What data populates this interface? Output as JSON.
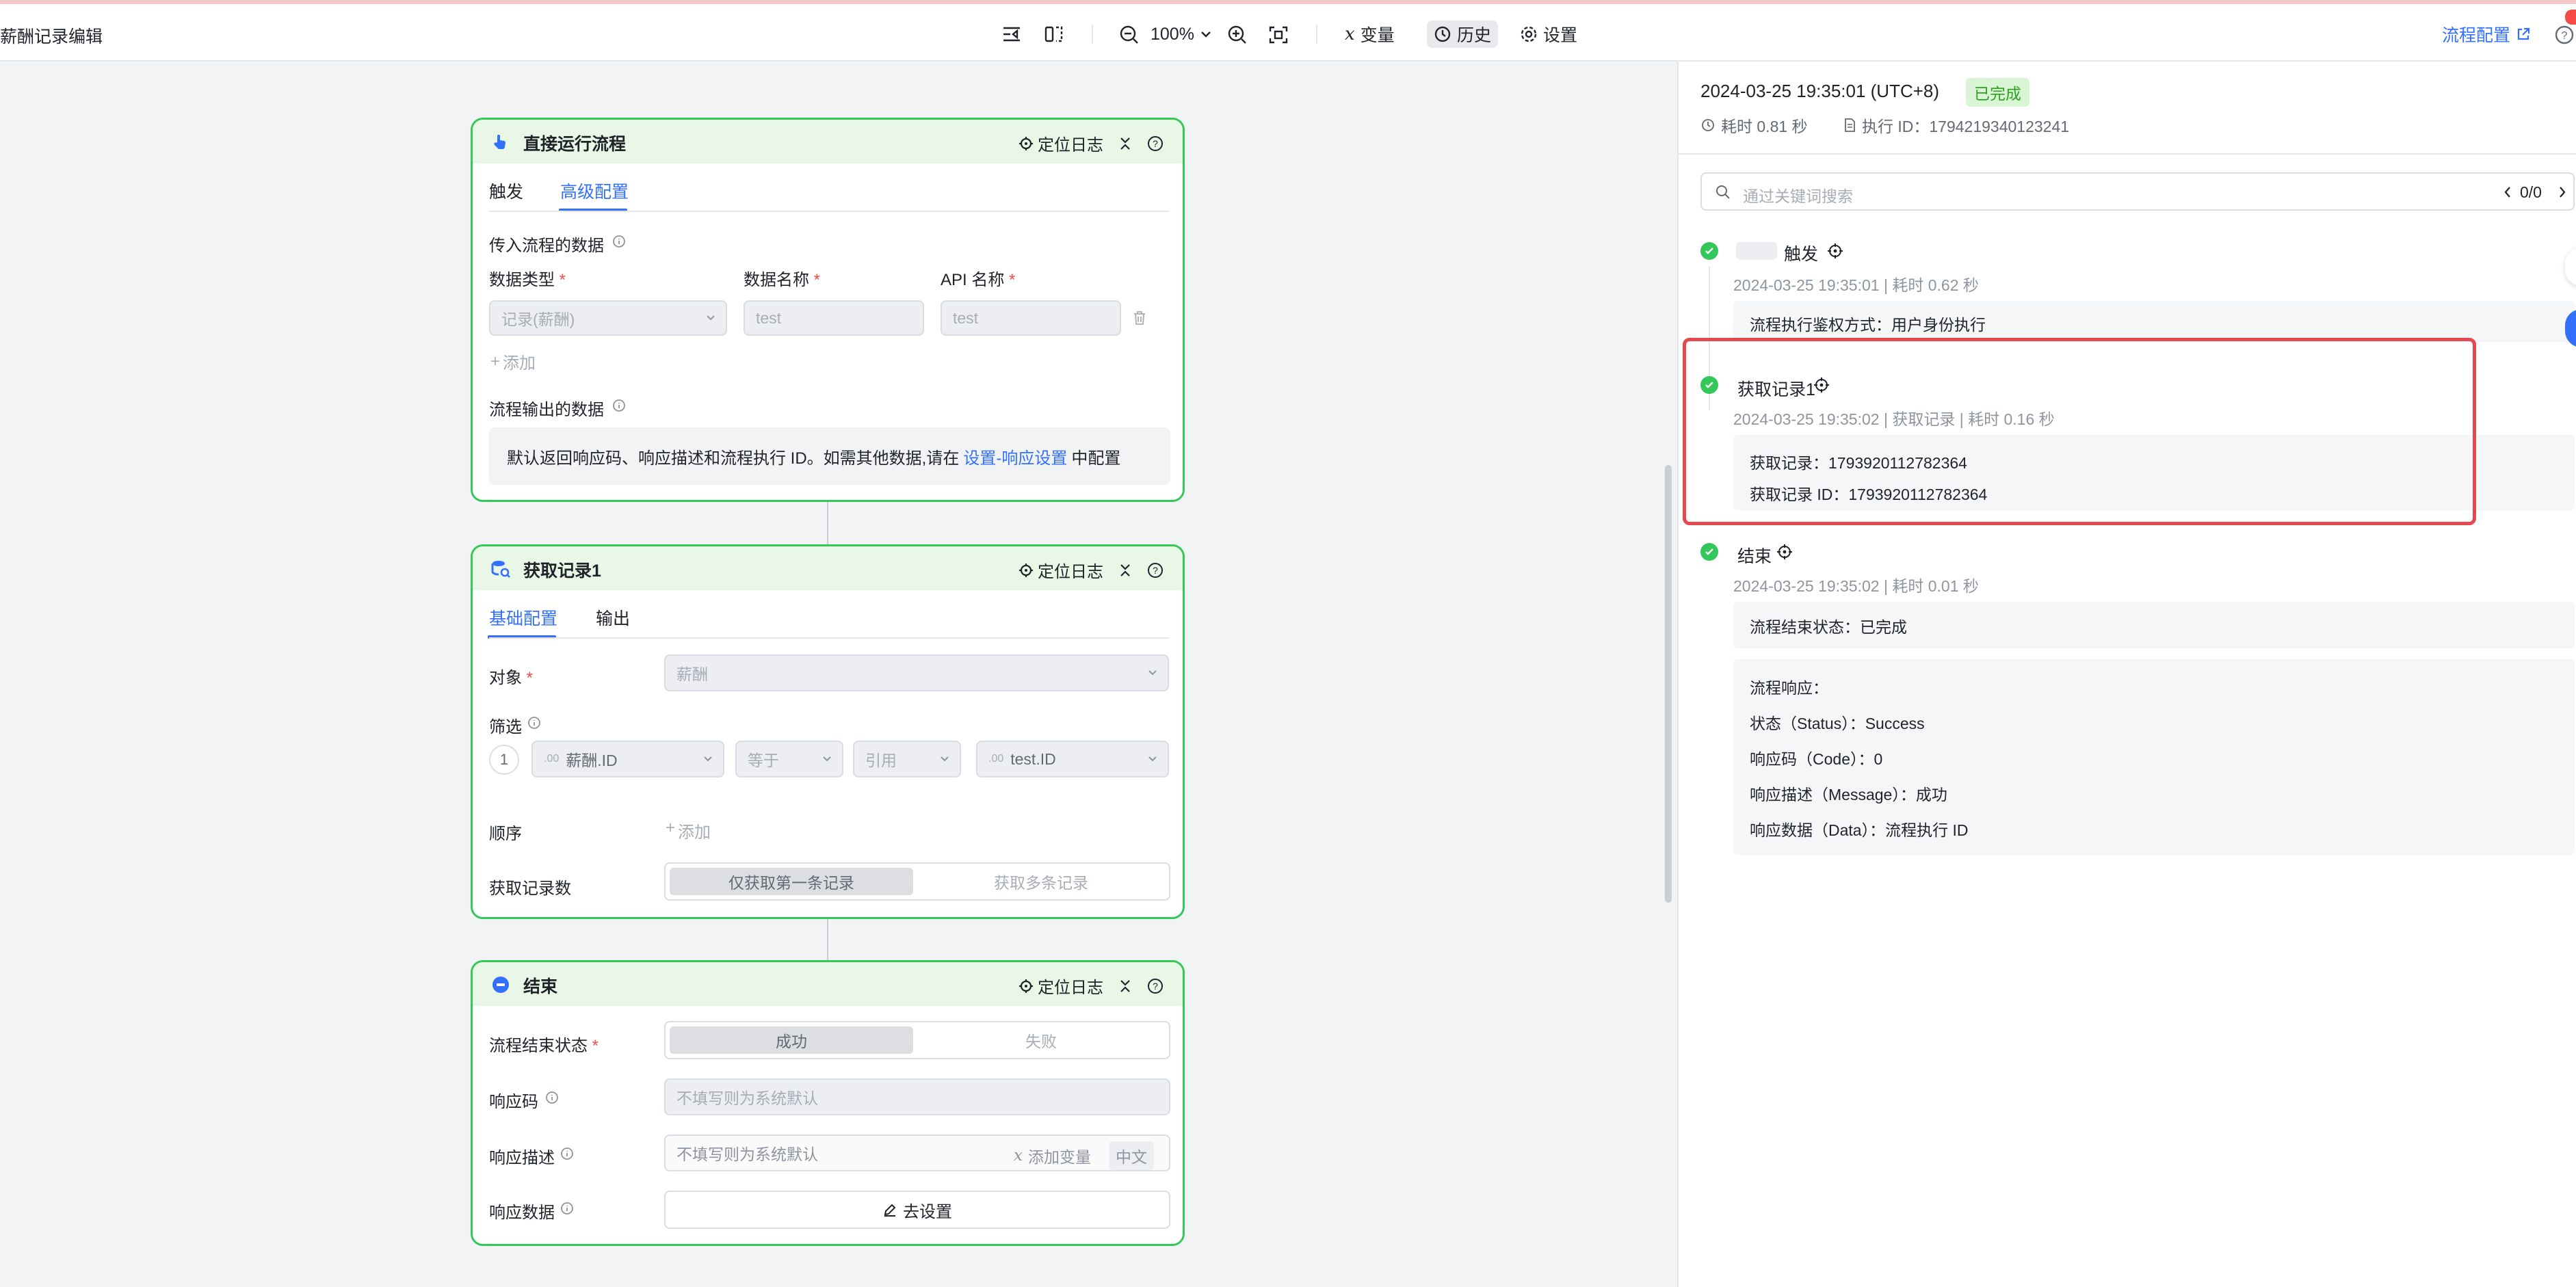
{
  "app": {
    "title": "薪酬记录编辑"
  },
  "toolbar": {
    "zoom": "100%",
    "variables": "变量",
    "history": "历史",
    "settings": "设置",
    "flow_config": "流程配置"
  },
  "card1": {
    "title": "直接运行流程",
    "locate_log": "定位日志",
    "tabs": [
      "触发",
      "高级配置"
    ],
    "input_section": "传入流程的数据",
    "col_type": "数据类型",
    "col_name": "数据名称",
    "col_api": "API 名称",
    "type_value": "记录(薪酬)",
    "name_value": "test",
    "api_value": "test",
    "add": "添加",
    "output_section": "流程输出的数据",
    "output_note": "默认返回响应码、响应描述和流程执行 ID。如需其他数据,请在",
    "output_link": "设置-响应设置",
    "output_suffix": "中配置"
  },
  "card2": {
    "title": "获取记录1",
    "locate_log": "定位日志",
    "tabs": [
      "基础配置",
      "输出"
    ],
    "object_label": "对象",
    "object_value": "薪酬",
    "filter_label": "筛选",
    "filter_index": "1",
    "filter_field": "薪酬.ID",
    "filter_op": "等于",
    "filter_ref": "引用",
    "filter_value": "test.ID",
    "order_label": "顺序",
    "order_add": "添加",
    "count_label": "获取记录数",
    "count_opt1": "仅获取第一条记录",
    "count_opt2": "获取多条记录"
  },
  "card3": {
    "title": "结束",
    "locate_log": "定位日志",
    "status_label": "流程结束状态",
    "status_opt1": "成功",
    "status_opt2": "失败",
    "code_label": "响应码",
    "code_placeholder": "不填写则为系统默认",
    "desc_label": "响应描述",
    "desc_placeholder": "不填写则为系统默认",
    "add_var": "添加变量",
    "lang": "中文",
    "data_label": "响应数据",
    "go_setting": "去设置"
  },
  "run": {
    "datetime": "2024-03-25 19:35:01 (UTC+8)",
    "status": "已完成",
    "duration": "耗时 0.81 秒",
    "exec_id": "执行 ID：1794219340123241",
    "search_placeholder": "通过关键词搜索",
    "search_count": "0/0",
    "steps": [
      {
        "title": "触发",
        "meta": "2024-03-25 19:35:01 | 耗时 0.62 秒",
        "lines": [
          "流程执行鉴权方式：用户身份执行"
        ]
      },
      {
        "title": "获取记录1",
        "meta": "2024-03-25 19:35:02 | 获取记录 | 耗时 0.16 秒",
        "lines": [
          "获取记录：1793920112782364",
          "获取记录 ID：1793920112782364"
        ]
      },
      {
        "title": "结束",
        "meta": "2024-03-25 19:35:02 | 耗时 0.01 秒",
        "lines": [
          "流程结束状态：已完成"
        ],
        "response_title": "流程响应：",
        "response_lines": [
          "状态（Status）：Success",
          "响应码（Code）：0",
          "响应描述（Message）：成功",
          "响应数据（Data）：流程执行 ID"
        ]
      }
    ]
  },
  "colors": {
    "accent": "#3370ff",
    "success": "#34c759",
    "highlight": "#e5484d",
    "card_head": "#e9f7e7"
  }
}
